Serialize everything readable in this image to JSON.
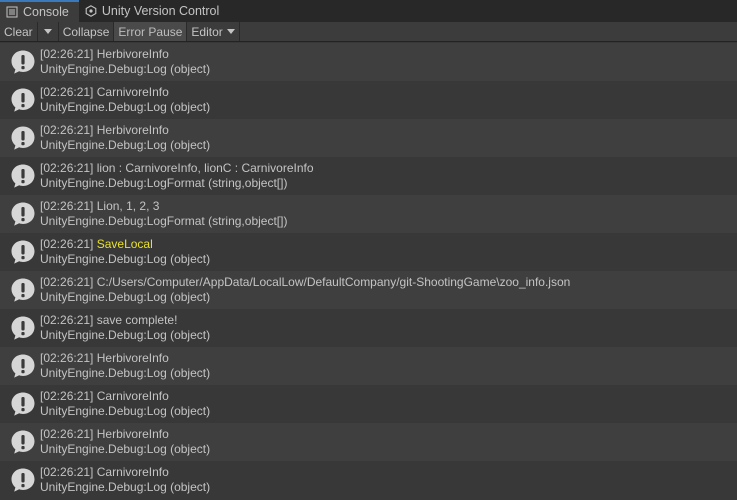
{
  "tabs": [
    {
      "label": "Console",
      "icon": "console-list-icon",
      "active": true
    },
    {
      "label": "Unity Version Control",
      "icon": "version-control-icon",
      "active": false
    }
  ],
  "toolbar": {
    "clear_label": "Clear",
    "collapse_label": "Collapse",
    "error_pause_label": "Error Pause",
    "editor_label": "Editor"
  },
  "colors": {
    "highlight": "#e8e02c",
    "active_tab_accent": "#3a79bb"
  },
  "entries": [
    {
      "time": "[02:26:21]",
      "message": "HerbivoreInfo",
      "highlight": false,
      "trace": "UnityEngine.Debug:Log (object)"
    },
    {
      "time": "[02:26:21]",
      "message": "CarnivoreInfo",
      "highlight": false,
      "trace": "UnityEngine.Debug:Log (object)"
    },
    {
      "time": "[02:26:21]",
      "message": "HerbivoreInfo",
      "highlight": false,
      "trace": "UnityEngine.Debug:Log (object)"
    },
    {
      "time": "[02:26:21]",
      "message": "lion : CarnivoreInfo, lionC : CarnivoreInfo",
      "highlight": false,
      "trace": "UnityEngine.Debug:LogFormat (string,object[])"
    },
    {
      "time": "[02:26:21]",
      "message": "Lion, 1, 2, 3",
      "highlight": false,
      "trace": "UnityEngine.Debug:LogFormat (string,object[])"
    },
    {
      "time": "[02:26:21]",
      "message": "SaveLocal",
      "highlight": true,
      "trace": "UnityEngine.Debug:Log (object)"
    },
    {
      "time": "[02:26:21]",
      "message": "C:/Users/Computer/AppData/LocalLow/DefaultCompany/git-ShootingGame\\zoo_info.json",
      "highlight": false,
      "trace": "UnityEngine.Debug:Log (object)"
    },
    {
      "time": "[02:26:21]",
      "message": "save complete!",
      "highlight": false,
      "trace": "UnityEngine.Debug:Log (object)"
    },
    {
      "time": "[02:26:21]",
      "message": "HerbivoreInfo",
      "highlight": false,
      "trace": "UnityEngine.Debug:Log (object)"
    },
    {
      "time": "[02:26:21]",
      "message": "CarnivoreInfo",
      "highlight": false,
      "trace": "UnityEngine.Debug:Log (object)"
    },
    {
      "time": "[02:26:21]",
      "message": "HerbivoreInfo",
      "highlight": false,
      "trace": "UnityEngine.Debug:Log (object)"
    },
    {
      "time": "[02:26:21]",
      "message": "CarnivoreInfo",
      "highlight": false,
      "trace": "UnityEngine.Debug:Log (object)"
    }
  ]
}
